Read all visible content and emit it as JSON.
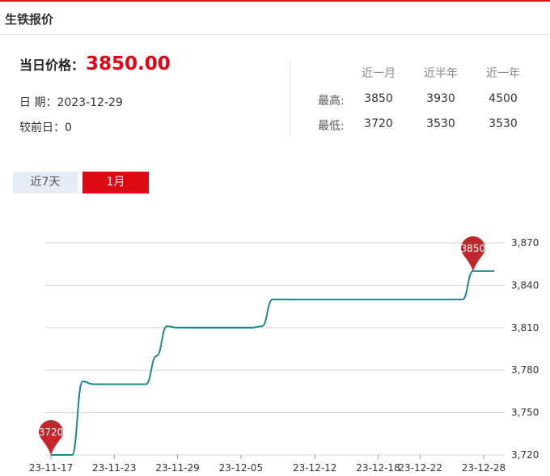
{
  "header": {
    "title": "生铁报价"
  },
  "summary": {
    "price_label": "当日价格：",
    "price_value": "3850.00",
    "date_label": "日 期：",
    "date_value": "2023-12-29",
    "change_label": "较前日：",
    "change_value": "0"
  },
  "stats": {
    "columns": [
      "近一月",
      "近半年",
      "近一年"
    ],
    "rows": [
      {
        "label": "最高:",
        "values": [
          "3850",
          "3930",
          "4500"
        ]
      },
      {
        "label": "最低:",
        "values": [
          "3720",
          "3530",
          "3530"
        ]
      }
    ]
  },
  "tabs": [
    {
      "label": "近7天",
      "active": false
    },
    {
      "label": "1月",
      "active": true
    }
  ],
  "colors": {
    "accent": "#dd0a13",
    "price": "#e60012",
    "line": "#1a8a8f",
    "pin": "#c0282d"
  },
  "chart_data": {
    "type": "line",
    "x": [
      "23-11-17",
      "23-11-18",
      "23-11-19",
      "23-11-20",
      "23-11-21",
      "23-11-22",
      "23-11-23",
      "23-11-24",
      "23-11-25",
      "23-11-26",
      "23-11-27",
      "23-11-28",
      "23-11-29",
      "23-11-30",
      "23-12-01",
      "23-12-02",
      "23-12-03",
      "23-12-04",
      "23-12-05",
      "23-12-06",
      "23-12-07",
      "23-12-08",
      "23-12-09",
      "23-12-10",
      "23-12-11",
      "23-12-12",
      "23-12-13",
      "23-12-14",
      "23-12-15",
      "23-12-16",
      "23-12-17",
      "23-12-18",
      "23-12-19",
      "23-12-20",
      "23-12-21",
      "23-12-22",
      "23-12-23",
      "23-12-24",
      "23-12-25",
      "23-12-26",
      "23-12-27",
      "23-12-28",
      "23-12-29"
    ],
    "x_tick_labels": [
      "23-11-17",
      "23-11-23",
      "23-11-29",
      "23-12-05",
      "23-12-12",
      "23-12-18",
      "23-12-22",
      "23-12-28"
    ],
    "series": [
      {
        "values": [
          3720,
          3720,
          3720,
          3772,
          3770,
          3770,
          3770,
          3770,
          3770,
          3770,
          3790,
          3811,
          3810,
          3810,
          3810,
          3810,
          3810,
          3810,
          3810,
          3810,
          3811,
          3830,
          3830,
          3830,
          3830,
          3830,
          3830,
          3830,
          3830,
          3830,
          3830,
          3830,
          3830,
          3830,
          3830,
          3830,
          3830,
          3830,
          3830,
          3830,
          3850,
          3850,
          3850
        ]
      }
    ],
    "ylim": [
      3720,
      3870
    ],
    "y_ticks": [
      "3,720",
      "3,750",
      "3,780",
      "3,810",
      "3,840",
      "3,870"
    ],
    "grid": true,
    "markers": [
      {
        "label": "3720",
        "index": 0,
        "value": 3720
      },
      {
        "label": "3850",
        "index": 40,
        "value": 3850
      }
    ]
  }
}
